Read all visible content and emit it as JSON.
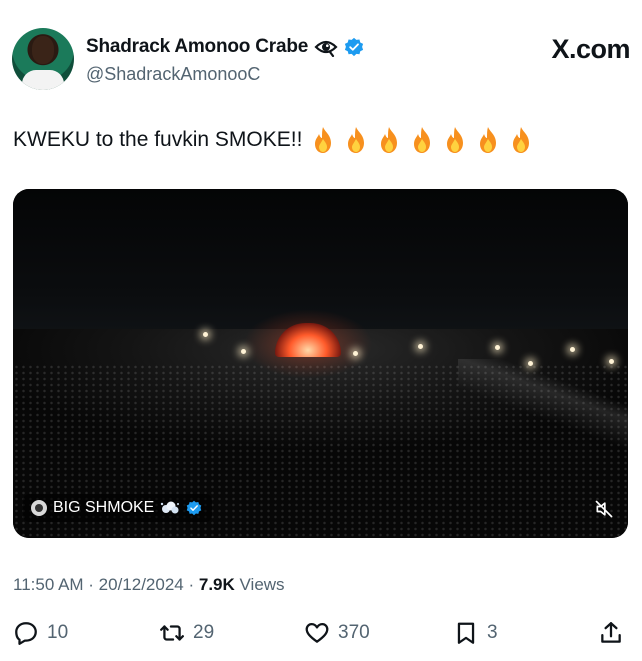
{
  "author": {
    "display_name": "Shadrack Amonoo Crabe",
    "handle": "@ShadrackAmonooC",
    "icons": [
      "eye-icon",
      "verified-icon"
    ]
  },
  "brand": {
    "label": "X.com"
  },
  "tweet": {
    "text": "KWEKU to the fuvkin SMOKE!!",
    "emoji": [
      "fire",
      "fire",
      "fire",
      "fire",
      "fire",
      "fire",
      "fire"
    ]
  },
  "video": {
    "channel_label": "BIG SHMOKE",
    "icons": [
      "smoke-icon",
      "verified-icon",
      "mute-icon"
    ]
  },
  "meta": {
    "timestamp": "11:50 AM · 20/12/2024 · ",
    "views_count": "7.9K",
    "views_label": " Views"
  },
  "actions": {
    "reply_count": "10",
    "repost_count": "29",
    "like_count": "370",
    "bookmark_count": "3"
  },
  "colors": {
    "text": "#0f1419",
    "secondary": "#536471",
    "verified": "#1d9bf0",
    "fire": "#f7901e"
  }
}
